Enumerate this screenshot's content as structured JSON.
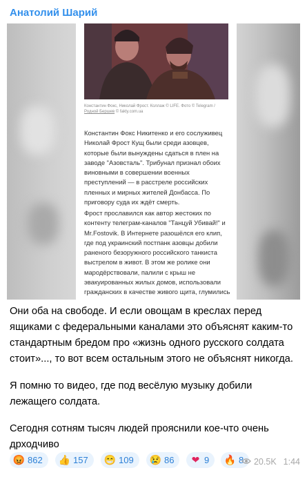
{
  "post": {
    "author": "Анатолий Шарий",
    "article": {
      "caption_text": "Константин Фокс, Николай Фрост. Коллаж © LIFE. Фото © Telegram /",
      "caption_link": "Родной Бершев",
      "caption_source": "© fakty.com.ua",
      "paragraph_1": "Константин Фокс Никитенко и его сослуживец Николай Фрост Кущ были среди азовцев, которые были вынуждены сдаться в плен на заводе \"Азовсталь\". Трибунал признал обоих виновными в совершении военных преступлений — в расстреле российских пленных и мирных жителей Донбасса. По приговору суда их ждёт смерть.",
      "paragraph_2": "Фрост прославился как автор жестоких по контенту телеграм-каналов \"Танцуй Убивай!\" и Mr.Fostovik. В Интернете разошёлся его клип, где под украинский постпанк азовцы добили раненого безоружного российского танкиста выстрелом в живот. В этом же ролике они мародёрствовали, палили с крыш не эвакуированных жилых домов, использовали гражданских в качестве живого щита, глумились над телами"
    },
    "message": {
      "p1": "Они оба на свободе. И если овощам в креслах перед ящиками с федеральными каналами это объяснят каким-то стандартным бредом про «жизнь одного русского солдата стоит»..., то вот всем остальным этого не объяснят никогда.",
      "p2": "Я помню то видео, где под весёлую музыку добили лежащего солдата.",
      "p3": "Сегодня сотням тысяч людей прояснили кое-что очень дрходчиво"
    },
    "reactions": [
      {
        "icon": "angry-face-icon",
        "emoji": "😡",
        "count": "862"
      },
      {
        "icon": "thumbs-up-icon",
        "emoji": "👍",
        "count": "157"
      },
      {
        "icon": "grinning-face-icon",
        "emoji": "😁",
        "count": "109"
      },
      {
        "icon": "crying-face-icon",
        "emoji": "😢",
        "count": "86"
      },
      {
        "icon": "heart-icon",
        "emoji": "❤",
        "count": "9"
      },
      {
        "icon": "fire-icon",
        "emoji": "🔥",
        "count": "8"
      }
    ],
    "views": "20.5K",
    "time": "1:44",
    "colors": {
      "author": "#3390ec",
      "reaction_bg": "#e9f3fd",
      "reaction_count": "#2b7fd6",
      "meta": "#a7a7a7"
    }
  }
}
